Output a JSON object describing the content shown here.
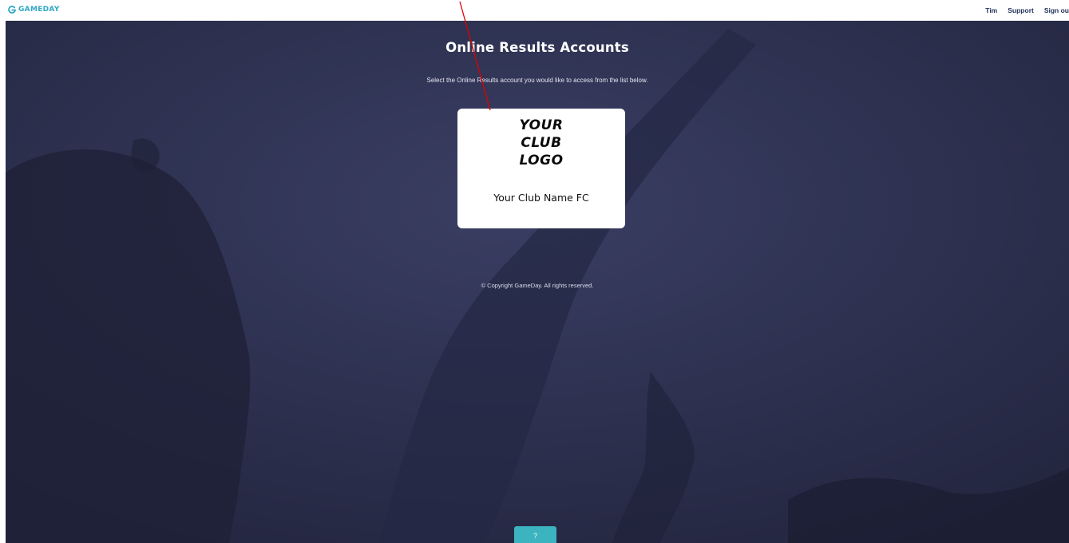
{
  "header": {
    "brand_label": "GAMEDAY",
    "nav": {
      "user_label": "Tim",
      "support_label": "Support",
      "signout_label": "Sign ou"
    }
  },
  "main": {
    "title": "Online Results Accounts",
    "subtitle": "Select the Online Results account you would like to access from the list below.",
    "card": {
      "logo_lines": [
        "YOUR",
        "CLUB",
        "LOGO"
      ],
      "club_name": "Your Club Name FC"
    },
    "copyright": "© Copyright GameDay. All rights reserved.",
    "help_label": "?"
  },
  "colors": {
    "brand": "#2fa8c6",
    "nav_text": "#22315a",
    "hero_bg": "#2a2d4e",
    "help_button": "#3cb4c0",
    "annotation_arrow": "#e00000"
  },
  "icons": {
    "brand_logo": "gameday-g-icon"
  }
}
